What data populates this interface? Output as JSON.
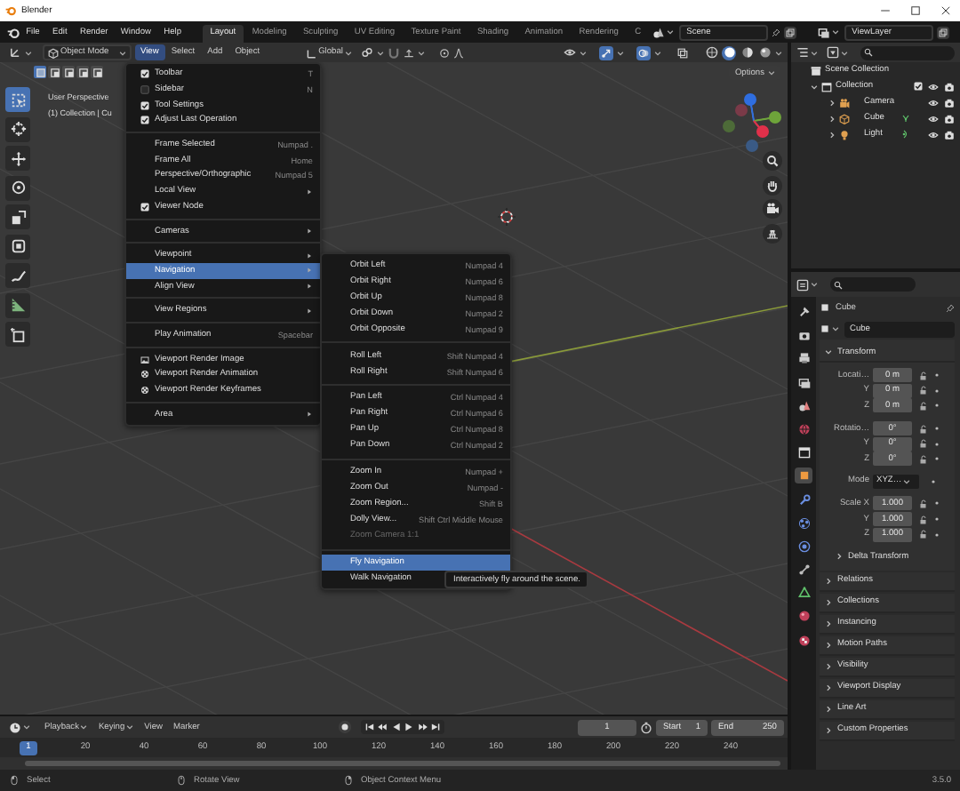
{
  "window": {
    "title": "Blender"
  },
  "menubar": [
    "File",
    "Edit",
    "Render",
    "Window",
    "Help"
  ],
  "workspaces": [
    {
      "label": "Layout",
      "selected": true
    },
    {
      "label": "Modeling",
      "selected": false
    },
    {
      "label": "Sculpting",
      "selected": false
    },
    {
      "label": "UV Editing",
      "selected": false
    },
    {
      "label": "Texture Paint",
      "selected": false
    },
    {
      "label": "Shading",
      "selected": false
    },
    {
      "label": "Animation",
      "selected": false
    },
    {
      "label": "Rendering",
      "selected": false
    },
    {
      "label": "C",
      "selected": false
    }
  ],
  "scene": "Scene",
  "view_layer": "ViewLayer",
  "viewport": {
    "mode": "Object Mode",
    "menus": [
      {
        "label": "View",
        "selected": true
      },
      {
        "label": "Select",
        "selected": false
      },
      {
        "label": "Add",
        "selected": false
      },
      {
        "label": "Object",
        "selected": false
      }
    ],
    "orientation": "Global",
    "toggles": [
      {
        "kind": "gizmo",
        "on": true
      },
      {
        "kind": "overlay",
        "on": true
      },
      {
        "kind": "xray",
        "on": false
      }
    ],
    "shading": [
      {
        "selected": false
      },
      {
        "selected": true
      },
      {
        "selected": false
      },
      {
        "selected": false
      }
    ],
    "select_modes": [
      {
        "selected": true
      },
      {
        "selected": false
      },
      {
        "selected": false
      },
      {
        "selected": false
      },
      {
        "selected": false
      }
    ],
    "options": "Options",
    "tools": [
      {
        "kind": "select",
        "selected": true
      },
      {
        "kind": "cursor",
        "selected": false
      },
      {
        "kind": "move",
        "selected": false
      },
      {
        "kind": "rotate",
        "selected": false
      },
      {
        "kind": "scale",
        "selected": false
      },
      {
        "kind": "transform",
        "selected": false
      },
      {
        "kind": "annotate",
        "selected": false
      },
      {
        "kind": "measure",
        "selected": false
      },
      {
        "kind": "add_cube",
        "selected": false
      }
    ],
    "overlay_text": [
      "User Perspective",
      "(1) Collection | Cu"
    ]
  },
  "view_menu": {
    "groups": [
      [
        {
          "kind": "check",
          "label": "Toolbar",
          "checked": true,
          "shortcut": "T",
          "selected": false
        },
        {
          "kind": "check",
          "label": "Sidebar",
          "checked": false,
          "shortcut": "N",
          "selected": false
        },
        {
          "kind": "check",
          "label": "Tool Settings",
          "checked": true,
          "selected": false
        },
        {
          "kind": "check",
          "label": "Adjust Last Operation",
          "checked": true,
          "selected": false
        }
      ],
      [
        {
          "kind": "action",
          "label": "Frame Selected",
          "shortcut": "Numpad .",
          "selected": false
        },
        {
          "kind": "action",
          "label": "Frame All",
          "shortcut": "Home",
          "selected": false
        },
        {
          "kind": "action",
          "label": "Perspective/Orthographic",
          "shortcut": "Numpad 5",
          "selected": false
        },
        {
          "kind": "submenu",
          "label": "Local View",
          "selected": false
        },
        {
          "kind": "check",
          "label": "Viewer Node",
          "checked": true,
          "selected": false
        }
      ],
      [
        {
          "kind": "submenu",
          "label": "Cameras",
          "selected": false
        }
      ],
      [
        {
          "kind": "submenu",
          "label": "Viewpoint",
          "selected": false
        },
        {
          "kind": "submenu",
          "label": "Navigation",
          "selected": true
        },
        {
          "kind": "submenu",
          "label": "Align View",
          "selected": false
        }
      ],
      [
        {
          "kind": "submenu",
          "label": "View Regions",
          "selected": false
        }
      ],
      [
        {
          "kind": "action",
          "label": "Play Animation",
          "shortcut": "Spacebar",
          "selected": false
        }
      ],
      [
        {
          "kind": "render_image",
          "label": "Viewport Render Image",
          "selected": false
        },
        {
          "kind": "render_animation",
          "label": "Viewport Render Animation",
          "selected": false
        },
        {
          "kind": "render_animation",
          "label": "Viewport Render Keyframes",
          "selected": false
        }
      ],
      [
        {
          "kind": "submenu",
          "label": "Area",
          "selected": false
        }
      ]
    ]
  },
  "navigation_menu": {
    "groups": [
      [
        {
          "label": "Orbit Left",
          "shortcut": "Numpad 4",
          "selected": false,
          "disabled": false
        },
        {
          "label": "Orbit Right",
          "shortcut": "Numpad 6",
          "selected": false,
          "disabled": false
        },
        {
          "label": "Orbit Up",
          "shortcut": "Numpad 8",
          "selected": false,
          "disabled": false
        },
        {
          "label": "Orbit Down",
          "shortcut": "Numpad 2",
          "selected": false,
          "disabled": false
        },
        {
          "label": "Orbit Opposite",
          "shortcut": "Numpad 9",
          "selected": false,
          "disabled": false
        }
      ],
      [
        {
          "label": "Roll Left",
          "shortcut": "Shift Numpad 4",
          "selected": false,
          "disabled": false
        },
        {
          "label": "Roll Right",
          "shortcut": "Shift Numpad 6",
          "selected": false,
          "disabled": false
        }
      ],
      [
        {
          "label": "Pan Left",
          "shortcut": "Ctrl Numpad 4",
          "selected": false,
          "disabled": false
        },
        {
          "label": "Pan Right",
          "shortcut": "Ctrl Numpad 6",
          "selected": false,
          "disabled": false
        },
        {
          "label": "Pan Up",
          "shortcut": "Ctrl Numpad 8",
          "selected": false,
          "disabled": false
        },
        {
          "label": "Pan Down",
          "shortcut": "Ctrl Numpad 2",
          "selected": false,
          "disabled": false
        }
      ],
      [
        {
          "label": "Zoom In",
          "shortcut": "Numpad +",
          "selected": false,
          "disabled": false
        },
        {
          "label": "Zoom Out",
          "shortcut": "Numpad -",
          "selected": false,
          "disabled": false
        },
        {
          "label": "Zoom Region...",
          "shortcut": "Shift B",
          "selected": false,
          "disabled": false
        },
        {
          "label": "Dolly View...",
          "shortcut": "Shift Ctrl Middle Mouse",
          "selected": false,
          "disabled": false
        },
        {
          "label": "Zoom Camera 1:1",
          "selected": false,
          "disabled": true
        }
      ],
      [
        {
          "label": "Fly Navigation",
          "selected": true,
          "disabled": false
        },
        {
          "label": "Walk Navigation",
          "selected": false,
          "disabled": false
        }
      ]
    ]
  },
  "tooltip": "Interactively fly around the scene.",
  "outliner": {
    "root": {
      "label": "Scene Collection",
      "children": [
        {
          "label": "Collection",
          "expanded": true,
          "checked": true,
          "children": [
            {
              "label": "Camera",
              "kind": "camera",
              "expanded": false
            },
            {
              "label": "Cube",
              "kind": "mesh",
              "expanded": false
            },
            {
              "label": "Light",
              "kind": "light",
              "expanded": false
            }
          ]
        }
      ]
    }
  },
  "properties": {
    "object_name": "Cube",
    "data_name": "Cube",
    "tabs": [
      {
        "kind": "tool",
        "selected": false
      },
      {
        "kind": "render",
        "selected": false
      },
      {
        "kind": "output",
        "selected": false
      },
      {
        "kind": "view_layer",
        "selected": false
      },
      {
        "kind": "scene",
        "selected": false
      },
      {
        "kind": "world",
        "selected": false
      },
      {
        "kind": "collection",
        "selected": false
      },
      {
        "kind": "object",
        "selected": true
      },
      {
        "kind": "modifiers",
        "selected": false
      },
      {
        "kind": "particles",
        "selected": false
      },
      {
        "kind": "physics",
        "selected": false
      },
      {
        "kind": "constraints",
        "selected": false
      },
      {
        "kind": "data",
        "selected": false
      },
      {
        "kind": "material",
        "selected": false
      },
      {
        "kind": "texture",
        "selected": false
      }
    ],
    "transform": {
      "title": "Transform",
      "expanded": true,
      "groups": [
        [
          {
            "kind": "number",
            "label": "Locati…",
            "value": "0 m"
          },
          {
            "kind": "number",
            "label": "Y",
            "value": "0 m"
          },
          {
            "kind": "number",
            "label": "Z",
            "value": "0 m"
          }
        ],
        [
          {
            "kind": "number",
            "label": "Rotatio…",
            "value": "0°"
          },
          {
            "kind": "number",
            "label": "Y",
            "value": "0°"
          },
          {
            "kind": "number",
            "label": "Z",
            "value": "0°"
          }
        ],
        [
          {
            "kind": "dropdown",
            "label": "Mode",
            "value": "XYZ…"
          }
        ],
        [
          {
            "kind": "number",
            "label": "Scale X",
            "value": "1.000"
          },
          {
            "kind": "number",
            "label": "Y",
            "value": "1.000"
          },
          {
            "kind": "number",
            "label": "Z",
            "value": "1.000"
          }
        ]
      ],
      "subpanel": {
        "title": "Delta Transform",
        "expanded": false
      }
    },
    "panels": [
      {
        "title": "Relations",
        "expanded": false
      },
      {
        "title": "Collections",
        "expanded": false
      },
      {
        "title": "Instancing",
        "expanded": false
      },
      {
        "title": "Motion Paths",
        "expanded": false
      },
      {
        "title": "Visibility",
        "expanded": false
      },
      {
        "title": "Viewport Display",
        "expanded": false
      },
      {
        "title": "Line Art",
        "expanded": false
      },
      {
        "title": "Custom Properties",
        "expanded": false
      }
    ]
  },
  "timeline": {
    "menus": [
      {
        "label": "Playback",
        "dropdown": true
      },
      {
        "label": "Keying",
        "dropdown": true
      },
      {
        "label": "View",
        "dropdown": false
      },
      {
        "label": "Marker",
        "dropdown": false
      }
    ],
    "current_frame": "1",
    "start_label": "Start",
    "start": "1",
    "end_label": "End",
    "end": "250",
    "ruler": [
      {
        "label": "1",
        "selected": true
      },
      {
        "label": "20",
        "selected": false
      },
      {
        "label": "40",
        "selected": false
      },
      {
        "label": "60",
        "selected": false
      },
      {
        "label": "80",
        "selected": false
      },
      {
        "label": "100",
        "selected": false
      },
      {
        "label": "120",
        "selected": false
      },
      {
        "label": "140",
        "selected": false
      },
      {
        "label": "160",
        "selected": false
      },
      {
        "label": "180",
        "selected": false
      },
      {
        "label": "200",
        "selected": false
      },
      {
        "label": "220",
        "selected": false
      },
      {
        "label": "240",
        "selected": false
      }
    ]
  },
  "status_bar": {
    "hints": [
      {
        "kind": "left_click",
        "label": "Select"
      },
      {
        "kind": "middle_click",
        "label": "Rotate View"
      },
      {
        "kind": "right_click",
        "label": "Object Context Menu"
      }
    ],
    "version": "3.5.0"
  }
}
